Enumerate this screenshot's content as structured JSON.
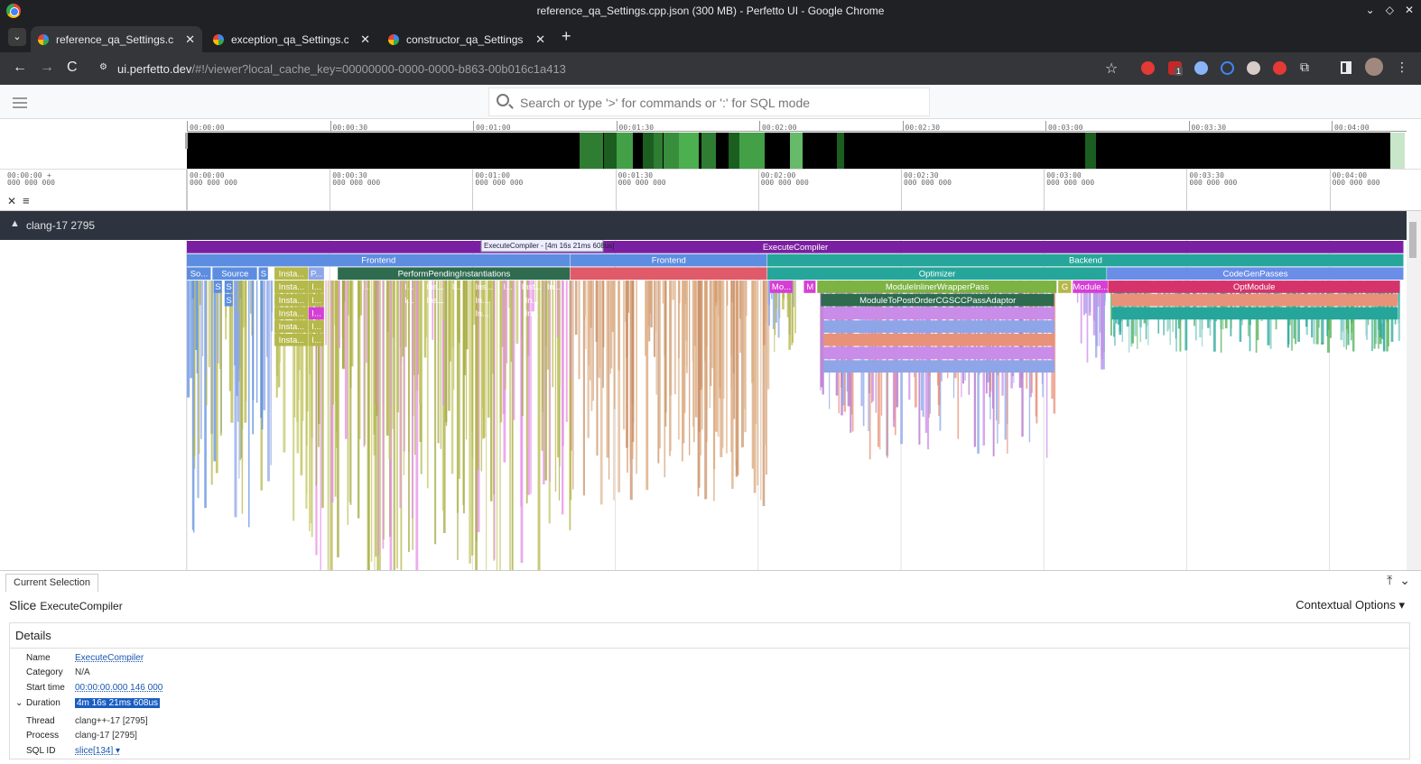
{
  "window": {
    "title": "reference_qa_Settings.cpp.json (300 MB) - Perfetto UI - Google Chrome",
    "controls": [
      "⌄",
      "◇",
      "✕"
    ]
  },
  "tabs": [
    {
      "label": "reference_qa_Settings.cpp.js",
      "active": true
    },
    {
      "label": "exception_qa_Settings.cpp.js",
      "active": false
    },
    {
      "label": "constructor_qa_Settings.cpp",
      "active": false
    }
  ],
  "toolbar": {
    "url_host": "ui.perfetto.dev",
    "url_path": "/#!/viewer?local_cache_key=00000000-0000-0000-b863-00b016c1a413",
    "badge": "1"
  },
  "perfetto": {
    "search_placeholder": "Search or type '>' for commands or ':' for SQL mode"
  },
  "overview": {
    "ticks": [
      "00:00:00",
      "00:00:30",
      "00:01:00",
      "00:01:30",
      "00:02:00",
      "00:02:30",
      "00:03:00",
      "00:03:30",
      "00:04:00"
    ]
  },
  "timeaxis": {
    "origin": "00:00:00",
    "origin_sub": "000 000 000",
    "plus": "+",
    "ticks": [
      {
        "t": "00:00:00",
        "s": "000 000 000"
      },
      {
        "t": "00:00:30",
        "s": "000 000 000"
      },
      {
        "t": "00:01:00",
        "s": "000 000 000"
      },
      {
        "t": "00:01:30",
        "s": "000 000 000"
      },
      {
        "t": "00:02:00",
        "s": "000 000 000"
      },
      {
        "t": "00:02:30",
        "s": "000 000 000"
      },
      {
        "t": "00:03:00",
        "s": "000 000 000"
      },
      {
        "t": "00:03:30",
        "s": "000 000 000"
      },
      {
        "t": "00:04:00",
        "s": "000 000 000"
      }
    ]
  },
  "track": {
    "process": "clang-17 2795",
    "tooltip": "ExecuteCompiler - [4m 16s 21ms 608us]",
    "slices": [
      {
        "label": "ExecuteCompiler",
        "depth": 0,
        "start": 0.0,
        "end": 1.0,
        "color": "#7b1fa2"
      },
      {
        "label": "Frontend",
        "depth": 1,
        "start": 0.0,
        "end": 0.315,
        "color": "#5c8de0"
      },
      {
        "label": "Frontend",
        "depth": 1,
        "start": 0.315,
        "end": 0.477,
        "color": "#5c8de0"
      },
      {
        "label": "Backend",
        "depth": 1,
        "start": 0.477,
        "end": 1.0,
        "color": "#26a69a"
      },
      {
        "label": "So...",
        "depth": 2,
        "start": 0.0,
        "end": 0.02,
        "color": "#5c8de0"
      },
      {
        "label": "Source",
        "depth": 2,
        "start": 0.021,
        "end": 0.058,
        "color": "#5c8de0"
      },
      {
        "label": "S",
        "depth": 2,
        "start": 0.059,
        "end": 0.067,
        "color": "#5c8de0"
      },
      {
        "label": "Insta...",
        "depth": 2,
        "start": 0.072,
        "end": 0.1,
        "color": "#b5b84a"
      },
      {
        "label": "P...",
        "depth": 2,
        "start": 0.1,
        "end": 0.113,
        "color": "#8ea5e8"
      },
      {
        "label": "PerformPendingInstantiations",
        "depth": 2,
        "start": 0.124,
        "end": 0.315,
        "color": "#2e6b4f"
      },
      {
        "label": "",
        "depth": 2,
        "start": 0.315,
        "end": 0.477,
        "color": "#e05a6a"
      },
      {
        "label": "Optimizer",
        "depth": 2,
        "start": 0.477,
        "end": 0.756,
        "color": "#26a69a"
      },
      {
        "label": "CodeGenPasses",
        "depth": 2,
        "start": 0.756,
        "end": 1.0,
        "color": "#6a8de8"
      },
      {
        "label": "S",
        "depth": 3,
        "start": 0.022,
        "end": 0.029,
        "color": "#5c8de0"
      },
      {
        "label": "S",
        "depth": 3,
        "start": 0.031,
        "end": 0.038,
        "color": "#5c8de0"
      },
      {
        "label": "Insta...",
        "depth": 3,
        "start": 0.072,
        "end": 0.1,
        "color": "#b5b84a"
      },
      {
        "label": "I...",
        "depth": 3,
        "start": 0.1,
        "end": 0.113,
        "color": "#b5b84a"
      },
      {
        "label": "Mo...",
        "depth": 3,
        "start": 0.479,
        "end": 0.498,
        "color": "#d63fd6"
      },
      {
        "label": "M",
        "depth": 3,
        "start": 0.507,
        "end": 0.517,
        "color": "#d63fd6"
      },
      {
        "label": "ModuleInlinerWrapperPass",
        "depth": 3,
        "start": 0.518,
        "end": 0.715,
        "color": "#7cb342"
      },
      {
        "label": "G",
        "depth": 3,
        "start": 0.716,
        "end": 0.727,
        "color": "#b5b84a"
      },
      {
        "label": "Module...",
        "depth": 3,
        "start": 0.728,
        "end": 0.757,
        "color": "#d63fd6"
      },
      {
        "label": "OptModule",
        "depth": 3,
        "start": 0.757,
        "end": 0.997,
        "color": "#d6336c"
      },
      {
        "label": "S",
        "depth": 4,
        "start": 0.031,
        "end": 0.038,
        "color": "#5c8de0"
      },
      {
        "label": "Insta...",
        "depth": 4,
        "start": 0.072,
        "end": 0.1,
        "color": "#b5b84a"
      },
      {
        "label": "I...",
        "depth": 4,
        "start": 0.1,
        "end": 0.113,
        "color": "#b5b84a"
      },
      {
        "label": "ModuleToPostOrderCGSCCPassAdaptor",
        "depth": 4,
        "start": 0.521,
        "end": 0.713,
        "color": "#2e6b4f"
      },
      {
        "label": "Insta...",
        "depth": 5,
        "start": 0.072,
        "end": 0.1,
        "color": "#b5b84a"
      },
      {
        "label": "I...",
        "depth": 5,
        "start": 0.1,
        "end": 0.113,
        "color": "#d63fd6"
      },
      {
        "label": "Insta...",
        "depth": 6,
        "start": 0.072,
        "end": 0.1,
        "color": "#b5b84a"
      },
      {
        "label": "I...",
        "depth": 6,
        "start": 0.1,
        "end": 0.113,
        "color": "#b5b84a"
      },
      {
        "label": "Insta...",
        "depth": 7,
        "start": 0.072,
        "end": 0.1,
        "color": "#b5b84a"
      },
      {
        "label": "I...",
        "depth": 7,
        "start": 0.1,
        "end": 0.113,
        "color": "#b5b84a"
      }
    ],
    "inline_labels": [
      {
        "label": "I...",
        "depth": 3,
        "pos": 0.144
      },
      {
        "label": "I...",
        "depth": 3,
        "pos": 0.179
      },
      {
        "label": "Ins...",
        "depth": 3,
        "pos": 0.197
      },
      {
        "label": "I...",
        "depth": 3,
        "pos": 0.218
      },
      {
        "label": "Ins...",
        "depth": 3,
        "pos": 0.237
      },
      {
        "label": "I...",
        "depth": 3,
        "pos": 0.26
      },
      {
        "label": "Inst...",
        "depth": 3,
        "pos": 0.275
      },
      {
        "label": "In...",
        "depth": 3,
        "pos": 0.296
      },
      {
        "label": "I...",
        "depth": 4,
        "pos": 0.179
      },
      {
        "label": "Ins...",
        "depth": 4,
        "pos": 0.197
      },
      {
        "label": "In...",
        "depth": 4,
        "pos": 0.237
      },
      {
        "label": "In...",
        "depth": 4,
        "pos": 0.278
      },
      {
        "label": "In...",
        "depth": 5,
        "pos": 0.237
      },
      {
        "label": "In...",
        "depth": 5,
        "pos": 0.278
      }
    ]
  },
  "details": {
    "tab": "Current Selection",
    "kind": "Slice",
    "name": "ExecuteCompiler",
    "contextual": "Contextual Options ▾",
    "panel_title": "Details",
    "rows": {
      "name_k": "Name",
      "name_v": "ExecuteCompiler",
      "category_k": "Category",
      "category_v": "N/A",
      "start_k": "Start time",
      "start_v": "00:00:00.000 146 000",
      "duration_k": "Duration",
      "duration_v": "4m 16s 21ms 608us",
      "thread_k": "Thread",
      "thread_v": "clang++-17 [2795]",
      "process_k": "Process",
      "process_v": "clang-17 [2795]",
      "sqlid_k": "SQL ID",
      "sqlid_v": "slice[134] ▾"
    }
  }
}
